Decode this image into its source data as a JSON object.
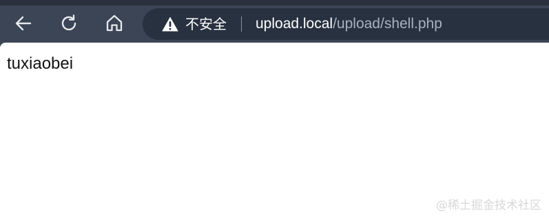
{
  "toolbar": {
    "back_icon": "back-arrow-icon",
    "reload_icon": "reload-icon",
    "home_icon": "home-icon"
  },
  "address_bar": {
    "security_icon": "warning-icon",
    "security_label": "不安全",
    "url_host": "upload.local",
    "url_path": "/upload/shell.php"
  },
  "page": {
    "body_text": "tuxiaobei"
  },
  "watermark": {
    "text": "@稀土掘金技术社区"
  },
  "colors": {
    "chrome_background": "#3c4555",
    "address_background": "#283140",
    "url_host": "#ffffff",
    "url_path": "#a8b1be",
    "page_background": "#ffffff"
  }
}
